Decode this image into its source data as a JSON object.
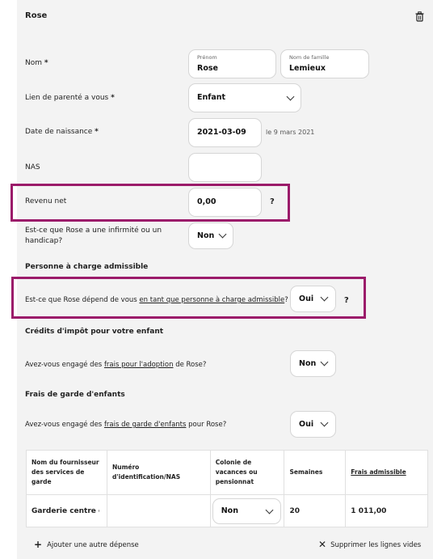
{
  "card": {
    "title": "Rose",
    "delete_icon": "trash-icon"
  },
  "nom": {
    "label": "Nom",
    "required": "*",
    "prenom_label": "Prénom",
    "prenom_value": "Rose",
    "famille_label": "Nom de famille",
    "famille_value": "Lemieux"
  },
  "lien": {
    "label": "Lien de parenté a vous",
    "required": "*",
    "value": "Enfant"
  },
  "naissance": {
    "label": "Date de naissance",
    "required": "*",
    "value": "2021-03-09",
    "hint": "le 9 mars 2021"
  },
  "nas": {
    "label": "NAS",
    "value": ""
  },
  "revenu": {
    "label": "Revenu net",
    "value": "0,00",
    "help": "?"
  },
  "infirmite": {
    "label_line1": "Est-ce que Rose a une infirmité ou un",
    "label_line2": "handicap?",
    "value": "Non"
  },
  "charge": {
    "heading": "Personne à charge admissible",
    "question_pre": "Est-ce que Rose dépend de vous",
    "question_link": "en tant que personne à charge admissible",
    "question_post": "?",
    "value": "Oui",
    "help": "?"
  },
  "credits": {
    "heading": "Crédits d'impôt pour votre enfant",
    "question_pre": "Avez-vous engagé des",
    "question_link": "frais pour l'adoption",
    "question_post": "de Rose?",
    "value": "Non"
  },
  "garde": {
    "heading": "Frais de garde d'enfants",
    "question_pre": "Avez-vous engagé des",
    "question_link": "frais de garde d'enfants",
    "question_post": "pour Rose?",
    "value": "Oui"
  },
  "table": {
    "headers": [
      "Nom du fournisseur des services de garde",
      "Numéro d'identification/NAS",
      "Colonie de vacances ou pensionnat",
      "Semaines",
      "Frais admissible"
    ],
    "row": {
      "fournisseur": "Garderie centre e",
      "identification": "",
      "colonie": "Non",
      "semaines": "20",
      "frais": "1 011,00"
    }
  },
  "footer": {
    "add_label": "Ajouter une autre dépense",
    "delete_label": "Supprimer les lignes vides"
  }
}
